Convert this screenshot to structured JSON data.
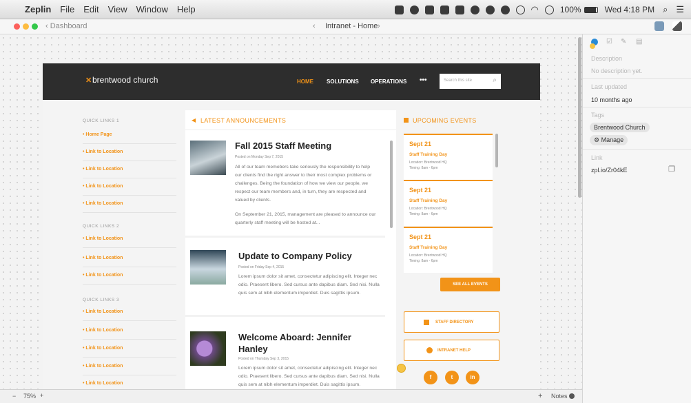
{
  "menubar": {
    "app": "Zeplin",
    "menus": [
      "File",
      "Edit",
      "View",
      "Window",
      "Help"
    ],
    "battery": "100%",
    "clock": "Wed 4:18 PM"
  },
  "toolbar": {
    "back_label": "Dashboard",
    "breadcrumb": "Intranet - Home"
  },
  "panel": {
    "description_label": "Description",
    "description_value": "No description yet.",
    "updated_label": "Last updated",
    "updated_value": "10 months ago",
    "tags_label": "Tags",
    "tag": "Brentwood Church",
    "manage": "Manage",
    "link_label": "Link",
    "link_value": "zpl.io/Zr04kE"
  },
  "bottombar": {
    "zoom": "75%",
    "notes": "Notes"
  },
  "site": {
    "logo": "brentwood church",
    "nav": [
      "HOME",
      "SOLUTIONS",
      "OPERATIONS",
      "•••"
    ],
    "search_placeholder": "Search this site",
    "quick_links": [
      {
        "heading": "QUICK LINKS 1",
        "items": [
          "Home Page",
          "Link to Location",
          "Link to Location",
          "Link to Location",
          "Link to Location"
        ]
      },
      {
        "heading": "QUICK LINKS 2",
        "items": [
          "Link to Location",
          "Link to Location",
          "Link to Location"
        ]
      },
      {
        "heading": "QUICK LINKS 3",
        "items": [
          "Link to Location",
          "Link to Location",
          "Link to Location",
          "Link to Location",
          "Link to Location"
        ]
      }
    ],
    "announcements_heading": "LATEST ANNOUNCEMENTS",
    "announcements": [
      {
        "title": "Fall 2015 Staff Meeting",
        "meta": "Posted on Monday Sep 7, 2015",
        "body": "All of our team memebers take seriously the responsibility to help our clients find the right answer to their most complex problems or challenges. Being the foundation of how we view our people, we respect our team members and, in turn, they are respected and valued by clients.",
        "body2": "On September 21, 2015, management are pleased to announce our quarterly staff meeting will be hosted at..."
      },
      {
        "title": "Update to Company Policy",
        "meta": "Posted on Friday Sep 4, 2015",
        "body": "Lorem ipsum dolor sit amet, consectetur adipiscing elit. Integer nec odio. Praesent libero. Sed cursus ante dapibus diam. Sed nisi. Nulla quis sem at nibh elementum imperdiet. Duis sagittis ipsum."
      },
      {
        "title": "Welcome Aboard: Jennifer Hanley",
        "meta": "Posted on Thursday Sep 3, 2015",
        "body": "Lorem ipsum dolor sit amet, consectetur adipiscing elit. Integer nec odio. Praesent libero. Sed cursus ante dapibus diam. Sed nisi. Nulla quis sem at nibh elementum imperdiet. Duis sagittis ipsum."
      }
    ],
    "events_heading": "UPCOMING EVENTS",
    "events": [
      {
        "date": "Sept 21",
        "name": "Staff Training Day",
        "location": "Location: Brentwood HQ",
        "timing": "Timing: 8am - 6pm"
      },
      {
        "date": "Sept 21",
        "name": "Staff Training Day",
        "location": "Location: Brentwood HQ",
        "timing": "Timing: 8am - 6pm"
      },
      {
        "date": "Sept 21",
        "name": "Staff Training Day",
        "location": "Location: Brentwood HQ",
        "timing": "Timing: 8am - 6pm"
      }
    ],
    "see_all": "SEE ALL EVENTS",
    "staff_directory": "STAFF DIRECTORY",
    "intranet_help": "INTRANET HELP",
    "social": [
      "f",
      "t",
      "in"
    ]
  },
  "colors": {
    "accent": "#f29318",
    "header": "#2d2d2d",
    "zeplin_blue": "#2a8bd6"
  }
}
